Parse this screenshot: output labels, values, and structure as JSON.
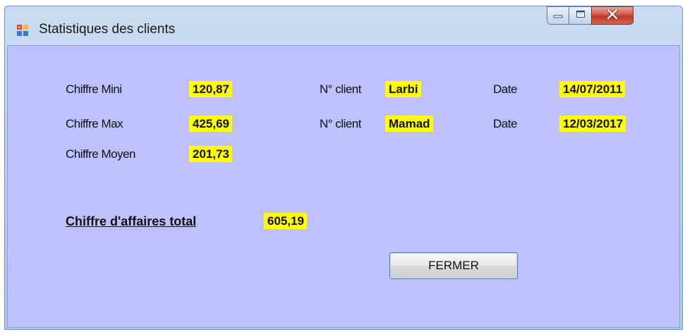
{
  "window": {
    "title": "Statistiques des clients",
    "app_icon": "windows-form-icon",
    "controls": {
      "minimize_icon": "minimize-icon",
      "maximize_icon": "maximize-icon",
      "close_icon": "close-icon"
    }
  },
  "colors": {
    "client_background": "#c0c0ff",
    "value_highlight": "#ffff00",
    "close_button": "#c0392b"
  },
  "stats": {
    "min": {
      "label": "Chiffre Mini",
      "value": "120,87",
      "client_label": "N° client",
      "client_value": "Larbi",
      "date_label": "Date",
      "date_value": "14/07/2011"
    },
    "max": {
      "label": "Chiffre Max",
      "value": "425,69",
      "client_label": "N° client",
      "client_value": "Mamad",
      "date_label": "Date",
      "date_value": "12/03/2017"
    },
    "avg": {
      "label": "Chiffre Moyen",
      "value": "201,73"
    },
    "total": {
      "label": "Chiffre d'affaires total",
      "value": "605,19"
    }
  },
  "buttons": {
    "close_label": "FERMER"
  }
}
